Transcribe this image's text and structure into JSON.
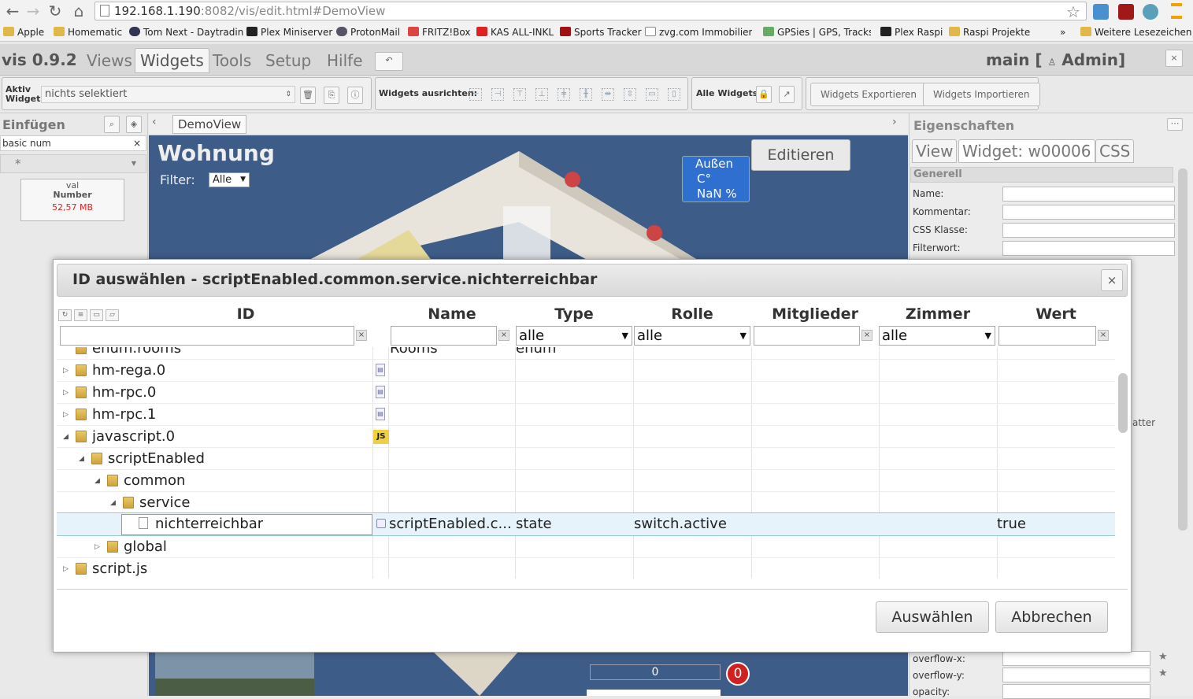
{
  "browser": {
    "url_host": "192.168.1.190",
    "url_rest": ":8082/vis/edit.html#DemoView",
    "bookmarks": [
      "Apple",
      "Homematic",
      "Tom Next - Daytradin",
      "Plex Miniserver",
      "ProtonMail",
      "FRITZ!Box",
      "KAS ALL-INKL",
      "Sports Tracker",
      "zvg.com Immobilien-Z",
      "GPSies | GPS, Tracks, S",
      "Plex Raspi",
      "Raspi Projekte"
    ],
    "more": "»",
    "other_bookmarks": "Weitere Lesezeichen"
  },
  "vis": {
    "logo": "vis 0.9.2",
    "tabs": [
      "Views",
      "Widgets",
      "Tools",
      "Setup",
      "Hilfe"
    ],
    "main_label": "main [",
    "user": "Admin]",
    "toolbar": {
      "aktiv_widget_label_1": "Aktiv",
      "aktiv_widget_label_2": "Widget:",
      "aktiv_widget_value": "nichts selektiert",
      "align_label": "Widgets ausrichten:",
      "all_widgets_label": "Alle Widgets:",
      "export_label": "Widgets Exportieren",
      "import_label": "Widgets Importieren"
    },
    "left": {
      "title": "Einfügen",
      "filter": "basic num",
      "star": "*",
      "card_line1": "val",
      "card_line2": "Number",
      "card_value": "52,57 MB"
    },
    "canvas": {
      "view_tab": "DemoView",
      "title": "Wohnung",
      "filter_label": "Filter:",
      "filter_value": "Alle",
      "edit_button": "Editieren",
      "aussen_line1": "Außen",
      "aussen_line2": "C°",
      "aussen_line3": "NaN %",
      "slider_value": "0",
      "badge": "0"
    },
    "right": {
      "title": "Eigenschaften",
      "tabs": [
        "View",
        "Widget: w00006",
        "CSS"
      ],
      "section": "Generell",
      "fields": [
        "Name:",
        "Kommentar:",
        "CSS Klasse:",
        "Filterwort:"
      ],
      "partial_label": "atter",
      "overflow_x": "overflow-x:",
      "overflow_y": "overflow-y:",
      "opacity": "opacity:"
    }
  },
  "dialog": {
    "title": "ID auswählen - scriptEnabled.common.service.nichterreichbar",
    "close": "×",
    "columns": [
      "ID",
      "Name",
      "Type",
      "Rolle",
      "Mitglieder",
      "Zimmer",
      "Wert"
    ],
    "filter_alle": "alle",
    "clear": "×",
    "rows": [
      {
        "label": "enum.rooms",
        "name": "Rooms",
        "type": "enum",
        "role": "",
        "value": ""
      },
      {
        "label": "hm-rega.0",
        "name": "",
        "type": "",
        "role": "",
        "value": ""
      },
      {
        "label": "hm-rpc.0",
        "name": "",
        "type": "",
        "role": "",
        "value": ""
      },
      {
        "label": "hm-rpc.1",
        "name": "",
        "type": "",
        "role": "",
        "value": ""
      },
      {
        "label": "javascript.0",
        "name": "",
        "type": "",
        "role": "",
        "value": ""
      },
      {
        "label": "scriptEnabled",
        "name": "",
        "type": "",
        "role": "",
        "value": ""
      },
      {
        "label": "common",
        "name": "",
        "type": "",
        "role": "",
        "value": ""
      },
      {
        "label": "service",
        "name": "",
        "type": "",
        "role": "",
        "value": ""
      },
      {
        "label": "nichterreichbar",
        "name": "scriptEnabled.c...",
        "type": "state",
        "role": "switch.active",
        "value": "true"
      },
      {
        "label": "global",
        "name": "",
        "type": "",
        "role": "",
        "value": ""
      },
      {
        "label": "script.js",
        "name": "",
        "type": "",
        "role": "",
        "value": ""
      }
    ],
    "js_badge": "JS",
    "select_button": "Auswählen",
    "cancel_button": "Abbrechen"
  }
}
